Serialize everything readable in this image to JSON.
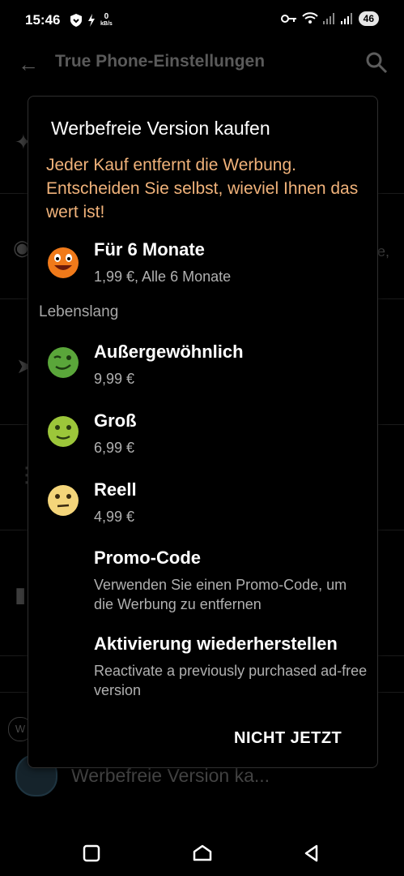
{
  "status_bar": {
    "time": "15:46",
    "net_speed_value": "0",
    "net_speed_unit": "kB/s",
    "battery": "46"
  },
  "app_bar": {
    "title": "True Phone-Einstellungen"
  },
  "background": {
    "fragment_right": "e,",
    "chip_label": "W",
    "bottom_item_label": "Werbefreie Version ka..."
  },
  "dialog": {
    "title": "Werbefreie Version kaufen",
    "subtitle": "Jeder Kauf entfernt die Werbung. Entscheiden Sie selbst, wieviel Ihnen das wert ist!",
    "subscription": {
      "title": "Für 6 Monate",
      "subtitle": "1,99 €, Alle 6 Monate"
    },
    "section_label": "Lebenslang",
    "lifetime_options": [
      {
        "title": "Außergewöhnlich",
        "price": "9,99 €"
      },
      {
        "title": "Groß",
        "price": "6,99 €"
      },
      {
        "title": "Reell",
        "price": "4,99 €"
      }
    ],
    "promo": {
      "title": "Promo-Code",
      "subtitle": "Verwenden Sie einen Promo-Code, um die Werbung zu entfernen"
    },
    "restore": {
      "title": "Aktivierung wiederherstellen",
      "subtitle": "Reactivate a previously purchased ad-free version"
    },
    "dismiss_label": "NICHT JETZT"
  },
  "colors": {
    "accent_orange": "#f0b27a",
    "dialog_bg": "#000000"
  }
}
